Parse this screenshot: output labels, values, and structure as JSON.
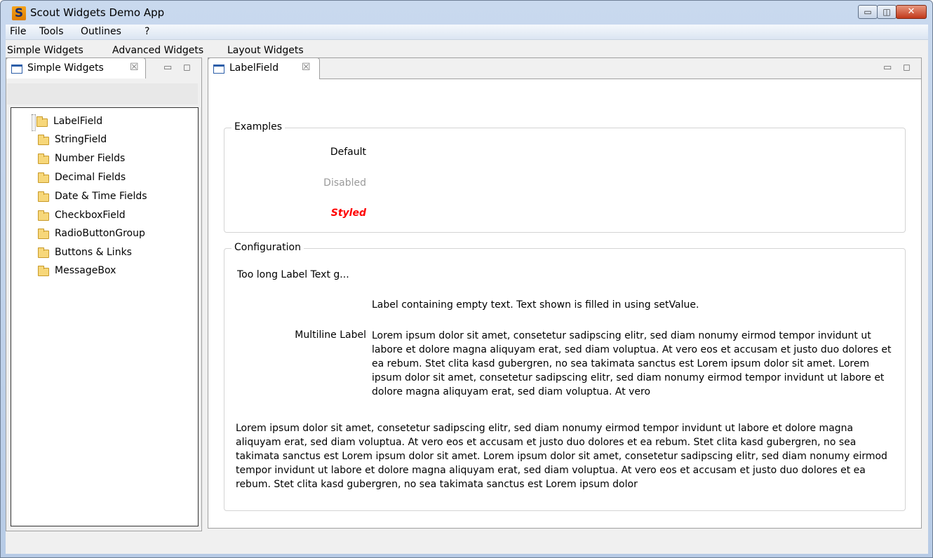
{
  "window": {
    "title": "Scout Widgets Demo App",
    "app_icon_letter": "S",
    "minimize_glyph": "▭",
    "maximize_glyph": "◫",
    "close_glyph": "✕"
  },
  "menu": [
    "File",
    "Tools",
    "Outlines",
    "?"
  ],
  "outlines": [
    "Simple Widgets",
    "Advanced Widgets",
    "Layout Widgets"
  ],
  "left_view": {
    "tab_label": "Simple Widgets",
    "close_glyph": "☒",
    "minimize_glyph": "▭",
    "maximize_glyph": "◻",
    "tree_items": [
      "LabelField",
      "StringField",
      "Number Fields",
      "Decimal Fields",
      "Date & Time Fields",
      "CheckboxField",
      "RadioButtonGroup",
      "Buttons & Links",
      "MessageBox"
    ],
    "selected_index": 0
  },
  "right_view": {
    "tab_label": "LabelField",
    "close_glyph": "☒",
    "minimize_glyph": "▭",
    "maximize_glyph": "◻",
    "examples": {
      "title": "Examples",
      "default_label": "Default",
      "disabled_label": "Disabled",
      "styled_label": "Styled"
    },
    "configuration": {
      "title": "Configuration",
      "too_long_label": "Too long Label Text g...",
      "empty_label_value": "Label containing empty text. Text shown is filled in using setValue.",
      "multiline_label": "Multiline Label",
      "multiline_value": "Lorem ipsum dolor sit amet, consetetur sadipscing elitr, sed diam nonumy eirmod tempor invidunt ut labore et dolore magna aliquyam erat, sed diam voluptua. At vero eos et accusam et justo duo dolores et ea rebum. Stet clita kasd gubergren, no sea takimata sanctus est Lorem ipsum dolor sit amet. Lorem ipsum dolor sit amet, consetetur sadipscing elitr, sed diam nonumy eirmod tempor invidunt ut labore et dolore magna aliquyam erat, sed diam voluptua. At vero",
      "full_width_text": "Lorem ipsum dolor sit amet, consetetur sadipscing elitr, sed diam nonumy eirmod tempor invidunt ut labore et dolore magna aliquyam erat, sed diam voluptua. At vero eos et accusam et justo duo dolores et ea rebum. Stet clita kasd gubergren, no sea takimata sanctus est Lorem ipsum dolor sit amet. Lorem ipsum dolor sit amet, consetetur sadipscing elitr, sed diam nonumy eirmod tempor invidunt ut labore et dolore magna aliquyam erat, sed diam voluptua. At vero eos et accusam et justo duo dolores et ea rebum. Stet clita kasd gubergren, no sea takimata sanctus est Lorem ipsum dolor"
    }
  },
  "colors": {
    "styled_label": "#ff0000",
    "disabled_label": "#9a9a9a"
  }
}
